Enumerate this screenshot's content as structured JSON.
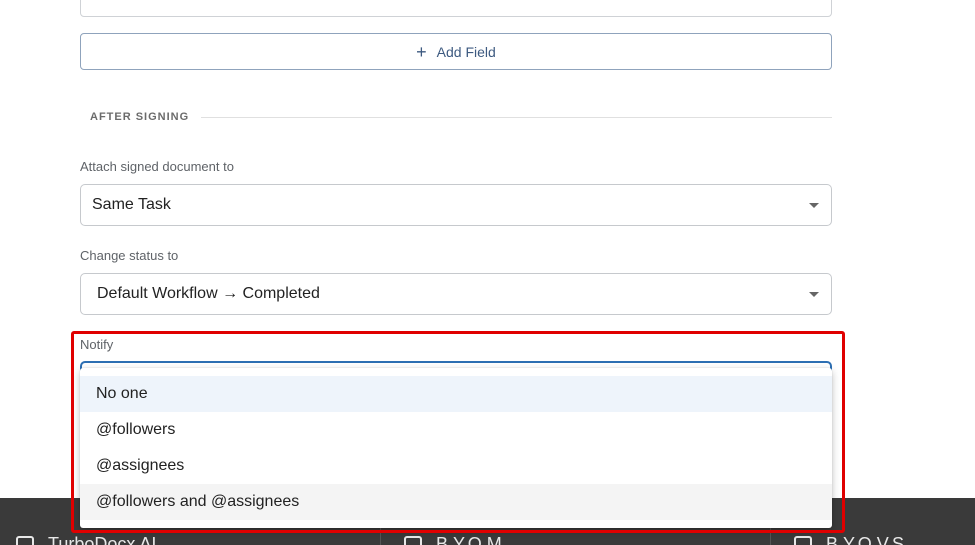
{
  "add_field": {
    "label": "Add Field"
  },
  "after_signing": {
    "title": "AFTER SIGNING"
  },
  "attach": {
    "label": "Attach signed document to",
    "value": "Same Task"
  },
  "status": {
    "label": "Change status to",
    "value": "Default Workflow → Completed"
  },
  "notify": {
    "label": "Notify",
    "options": [
      "No one",
      "@followers",
      "@assignees",
      "@followers and @assignees"
    ],
    "selected": "No one"
  },
  "taskbar": {
    "items": [
      "TurboDocx AI",
      "B.Y.O.M",
      "B.Y.O.V.S"
    ]
  },
  "colors": {
    "highlight": "#e00000",
    "focus": "#2d6fb3",
    "accent_text": "#3d5a80"
  },
  "icons": [
    "plus-icon",
    "chevron-down-icon",
    "app-icon"
  ]
}
